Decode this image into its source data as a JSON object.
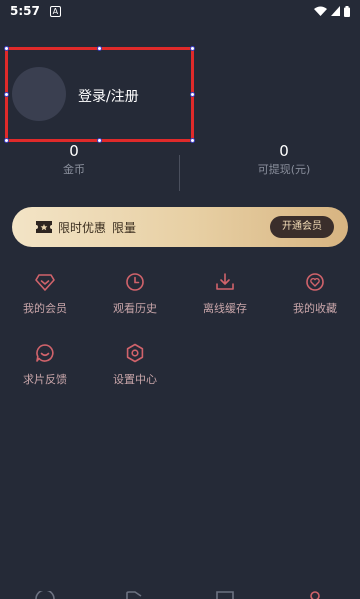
{
  "status_bar": {
    "time": "5:57",
    "notification_letter": "A"
  },
  "profile": {
    "login_label": "登录/注册"
  },
  "stats": [
    {
      "value": "0",
      "label": "金币"
    },
    {
      "value": "0",
      "label": "可提现(元)"
    }
  ],
  "vip_banner": {
    "text": "限时优惠",
    "tag": "限量",
    "button_label": "开通会员"
  },
  "menu": [
    {
      "label": "我的会员",
      "icon": "diamond-icon"
    },
    {
      "label": "观看历史",
      "icon": "clock-icon"
    },
    {
      "label": "离线缓存",
      "icon": "download-icon"
    },
    {
      "label": "我的收藏",
      "icon": "heart-icon"
    },
    {
      "label": "求片反馈",
      "icon": "chat-icon"
    },
    {
      "label": "设置中心",
      "icon": "gear-icon"
    }
  ],
  "colors": {
    "background": "#252a37",
    "accent": "#d1636b",
    "selection": "#e02a2a"
  }
}
